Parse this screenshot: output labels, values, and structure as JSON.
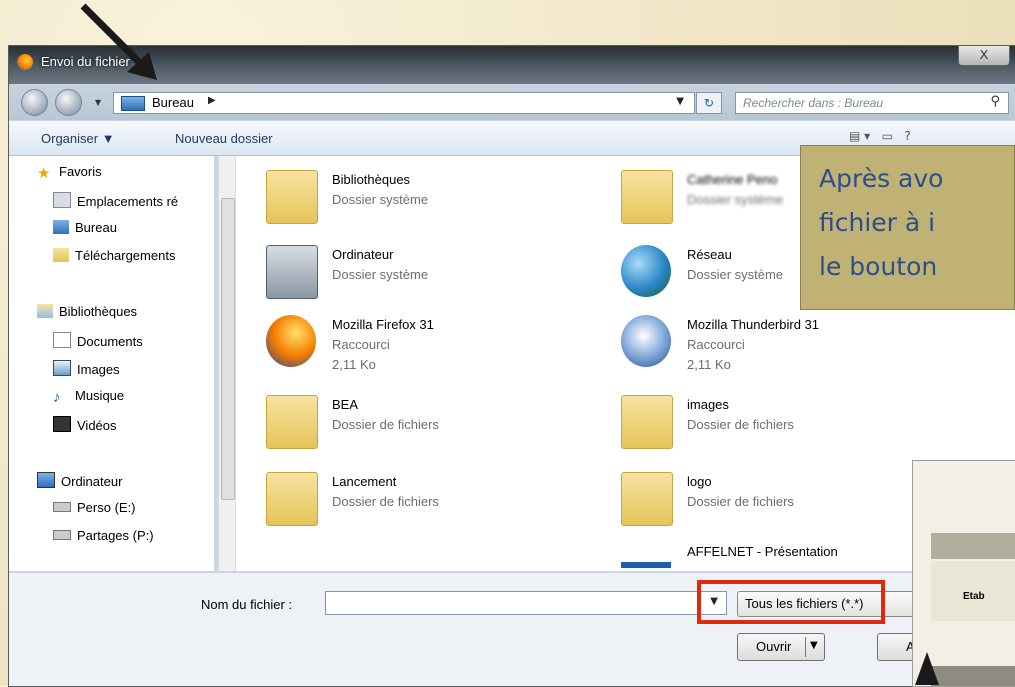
{
  "window": {
    "title": "Envoi du fichier",
    "close_label": "X"
  },
  "navbar": {
    "address": "Bureau",
    "search_placeholder": "Rechercher dans : Bureau"
  },
  "commandbar": {
    "organize": "Organiser ▼",
    "new_folder": "Nouveau dossier"
  },
  "sidebar": {
    "items": [
      {
        "label": "Favoris"
      },
      {
        "label": "Emplacements ré"
      },
      {
        "label": "Bureau"
      },
      {
        "label": "Téléchargements"
      },
      {
        "label": "Bibliothèques"
      },
      {
        "label": "Documents"
      },
      {
        "label": "Images"
      },
      {
        "label": "Musique"
      },
      {
        "label": "Vidéos"
      },
      {
        "label": "Ordinateur"
      },
      {
        "label": "Perso (E:)"
      },
      {
        "label": "Partages (P:)"
      }
    ]
  },
  "files": [
    {
      "name": "Bibliothèques",
      "type": "Dossier système",
      "size": ""
    },
    {
      "name": "Catherine Peno",
      "type": "Dossier système",
      "size": ""
    },
    {
      "name": "Ordinateur",
      "type": "Dossier système",
      "size": ""
    },
    {
      "name": "Réseau",
      "type": "Dossier système",
      "size": ""
    },
    {
      "name": "Mozilla Firefox 31",
      "type": "Raccourci",
      "size": "2,11 Ko"
    },
    {
      "name": "Mozilla Thunderbird 31",
      "type": "Raccourci",
      "size": "2,11 Ko"
    },
    {
      "name": "BEA",
      "type": "Dossier de fichiers",
      "size": ""
    },
    {
      "name": "images",
      "type": "Dossier de fichiers",
      "size": ""
    },
    {
      "name": "Lancement",
      "type": "Dossier de fichiers",
      "size": ""
    },
    {
      "name": "logo",
      "type": "Dossier de fichiers",
      "size": ""
    },
    {
      "name": "AFFELNET - Présentation",
      "type": "",
      "size": ""
    }
  ],
  "bottom": {
    "filename_label": "Nom du fichier :",
    "filename_value": "",
    "filter": "Tous les fichiers (*.*)",
    "open": "Ouvrir",
    "cancel": "A"
  },
  "callout": {
    "lines": [
      "Après avo",
      "fichier à i",
      "le bouton"
    ]
  },
  "peek": {
    "label": "Etab"
  },
  "colors": {
    "highlight_box": "#e02a10",
    "callout_bg": "#bfb274",
    "callout_text": "#2d4e8a"
  }
}
